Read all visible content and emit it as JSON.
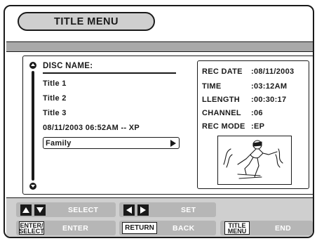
{
  "header": {
    "title": "TITLE MENU"
  },
  "disc": {
    "label": "DISC NAME:"
  },
  "titles": [
    {
      "label": "Title 1"
    },
    {
      "label": "Title 2"
    },
    {
      "label": "Title 3"
    },
    {
      "label": "08/11/2003 06:52AM -- XP"
    },
    {
      "label": "Family"
    }
  ],
  "info": {
    "rec_date_label": "REC DATE",
    "rec_date_value": ":08/11/2003",
    "time_label": "TIME",
    "time_value": ":03:12AM",
    "length_label": "LLENGTH",
    "length_value": ":00:30:17",
    "channel_label": "CHANNEL",
    "channel_value": ":06",
    "rec_mode_label": "REC MODE",
    "rec_mode_value": ":EP",
    "thumbnail_icon": "skier-illustration"
  },
  "footer": {
    "select_label": "SELECT",
    "set_label": "SET",
    "enter_key_line1": "ENTER/",
    "enter_key_line2": "SELECT",
    "enter_label": "ENTER",
    "return_key": "RETURN",
    "back_label": "BACK",
    "title_key_line1": "TITLE",
    "title_key_line2": "MENU",
    "end_label": "END"
  }
}
